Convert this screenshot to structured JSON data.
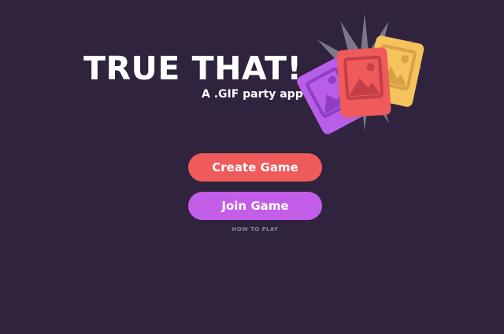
{
  "logo": {
    "title": "TRUE THAT!",
    "subtitle": "A .GIF party app"
  },
  "menu": {
    "create_label": "Create Game",
    "join_label": "Join Game",
    "how_to_play_label": "HOW TO PLAY"
  },
  "illustration": {
    "icons": [
      "starburst",
      "purple-image-card-icon",
      "red-image-card-icon",
      "yellow-image-card-icon"
    ]
  },
  "colors": {
    "background": "#2f233d",
    "create_button": "#ef5a5a",
    "join_button": "#c35ee8",
    "card_yellow": "#f4c35c",
    "card_red": "#ef5a5a",
    "card_purple": "#b95ee8",
    "starburst": "#7d7888",
    "muted_text": "#8a8295"
  }
}
